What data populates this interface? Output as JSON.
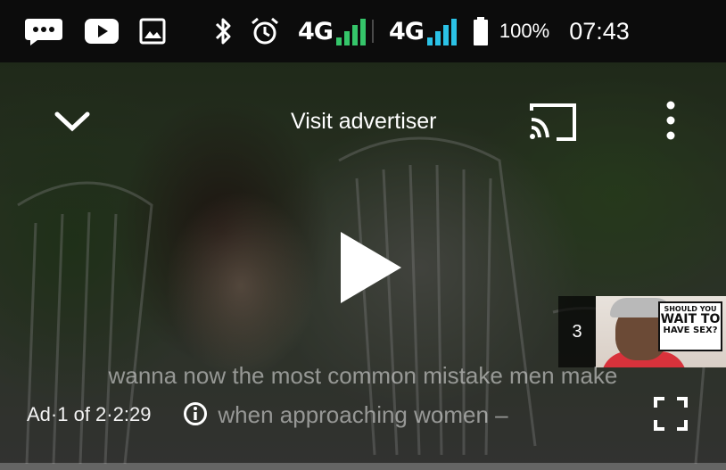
{
  "status_bar": {
    "left_icons": [
      "messages-icon",
      "youtube-icon",
      "image-icon"
    ],
    "right_icons": [
      "bluetooth-icon",
      "alarm-icon"
    ],
    "network_1": "4G",
    "network_2": "4G",
    "battery_percent": "100%",
    "time": "07:43",
    "colors": {
      "signal": "#35c56a",
      "signal2": "#2bc2e6"
    }
  },
  "player": {
    "top_bar": {
      "collapse_icon": "chevron-down-icon",
      "visit_advertiser": "Visit advertiser",
      "cast_icon": "cast-icon",
      "more_icon": "more-vertical-icon"
    },
    "center": {
      "play_icon": "play-icon"
    },
    "up_next": {
      "count": "3",
      "thumbnail_text": [
        "SHOULD YOU",
        "WAIT TO",
        "HAVE SEX?"
      ]
    },
    "captions": {
      "line1": "wanna now the most common mistake men make",
      "line2": "when approaching women –"
    },
    "ad_info": "Ad·1 of 2·2:29",
    "info_icon": "info-icon",
    "fullscreen_icon": "fullscreen-icon",
    "progress": 0.0,
    "colors": {
      "progress": "#f4c20d"
    }
  }
}
